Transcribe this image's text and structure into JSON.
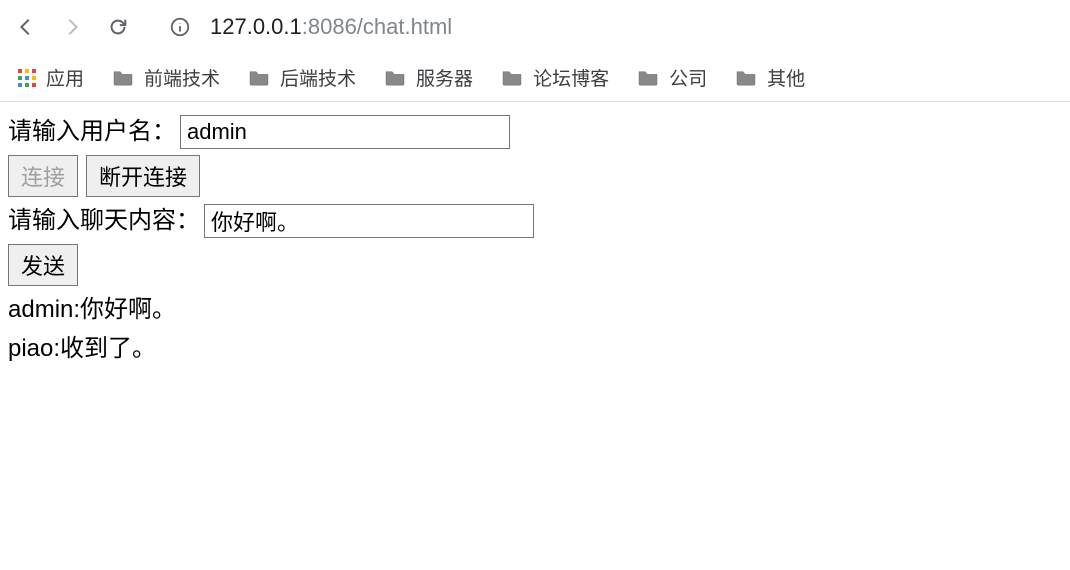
{
  "browser": {
    "url_host": "127.0.0.1",
    "url_port_path": ":8086/chat.html"
  },
  "bookmarks": {
    "apps_label": "应用",
    "items": [
      {
        "label": "前端技术"
      },
      {
        "label": "后端技术"
      },
      {
        "label": "服务器"
      },
      {
        "label": "论坛博客"
      },
      {
        "label": "公司"
      },
      {
        "label": "其他"
      }
    ]
  },
  "page": {
    "username_label": "请输入用户名：",
    "username_value": "admin",
    "connect_label": "连接",
    "disconnect_label": "断开连接",
    "message_label": "请输入聊天内容：",
    "message_value": "你好啊。",
    "send_label": "发送",
    "log": [
      "admin:你好啊。",
      "piao:收到了。"
    ]
  }
}
